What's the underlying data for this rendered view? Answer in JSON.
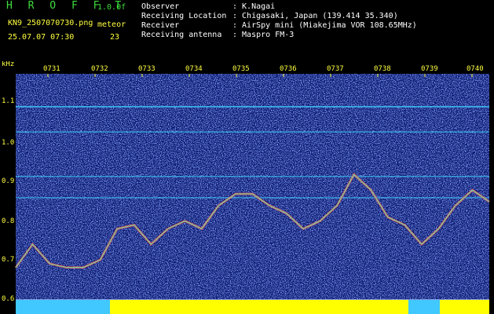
{
  "header": {
    "app_name": "H R O F F T",
    "version": "1.0.0f",
    "filename": "KN9_2507070730.png",
    "meteor_label": "meteor",
    "datetime": "25.07.07 07:30",
    "meteor_count": "23",
    "info": [
      {
        "label": "Observer",
        "value": ": K.Nagai"
      },
      {
        "label": "Receiving Location",
        "value": ": Chigasaki, Japan (139.414 35.340)"
      },
      {
        "label": "Receiver",
        "value": ": AirSpy mini (Miakejima VOR 108.65MHz)"
      },
      {
        "label": "Receiving antenna",
        "value": ": Maspro FM-3"
      }
    ]
  },
  "spectrogram": {
    "freq_unit": "kHz",
    "freq_ticks": [
      "1.1",
      "1.0",
      "0.9",
      "0.8",
      "0.7",
      "0.6"
    ],
    "time_ticks": [
      "0731",
      "0732",
      "0733",
      "0734",
      "0735",
      "0736",
      "0737",
      "0738",
      "0739",
      "0740"
    ],
    "colors": {
      "background": "#0c1a6e",
      "noise": "#3a5cff",
      "carrier": "#40d0ff",
      "signal": "#ff4040",
      "text": "#ffff40",
      "gauge": "#ffff00",
      "gauge_low": "#40c8ff"
    }
  },
  "chart_data": {
    "type": "line",
    "title": "",
    "xlabel": "",
    "ylabel": "kHz",
    "x": [
      "07:30.0",
      "07:30.5",
      "07:31.0",
      "07:31.5",
      "07:32.0",
      "07:32.5",
      "07:33.0",
      "07:33.5",
      "07:34.0",
      "07:34.5",
      "07:35.0",
      "07:35.5",
      "07:36.0",
      "07:36.5",
      "07:37.0",
      "07:37.5",
      "07:38.0",
      "07:38.5",
      "07:39.0",
      "07:39.5",
      "07:40.0",
      "07:40.3"
    ],
    "series": [
      {
        "values": [
          0.7,
          0.76,
          0.71,
          0.7,
          0.7,
          0.72,
          0.8,
          0.81,
          0.76,
          0.8,
          0.82,
          0.8,
          0.86,
          0.89,
          0.89,
          0.86,
          0.84,
          0.8,
          0.82,
          0.86,
          0.94,
          0.9,
          0.83,
          0.81,
          0.76,
          0.8,
          0.86,
          0.9,
          0.87
        ]
      }
    ],
    "horizontal_lines_khz": [
      1.115,
      1.05,
      0.935,
      0.88
    ],
    "ylim": [
      0.58,
      1.2
    ]
  }
}
